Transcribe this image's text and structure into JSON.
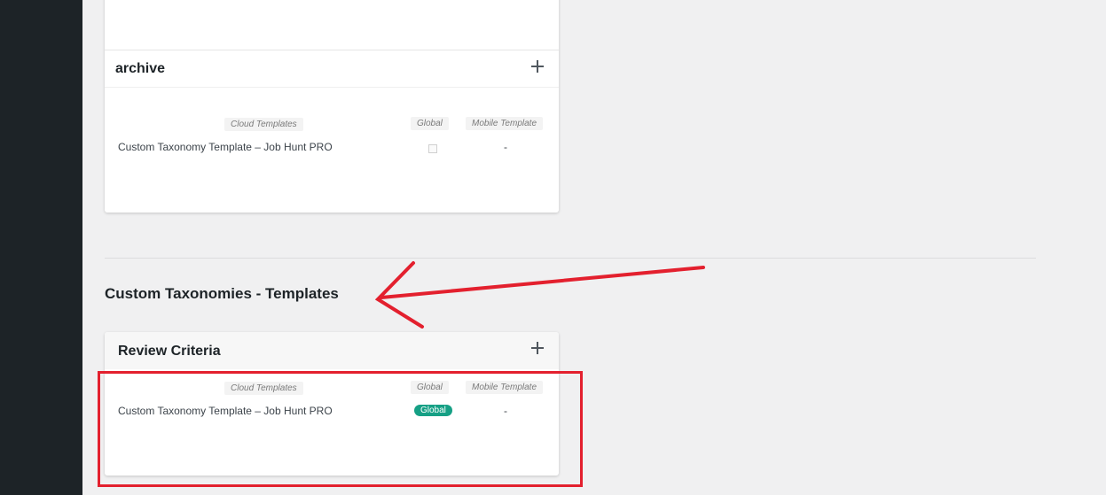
{
  "archive_card": {
    "title": "archive",
    "columns": {
      "cloud": "Cloud Templates",
      "global": "Global",
      "mobile": "Mobile Template"
    },
    "row": {
      "name": "Custom Taxonomy Template – Job Hunt PRO",
      "mobile": "-"
    }
  },
  "section": {
    "title": "Custom Taxonomies - Templates"
  },
  "review_card": {
    "title": "Review Criteria",
    "columns": {
      "cloud": "Cloud Templates",
      "global": "Global",
      "mobile": "Mobile Template"
    },
    "row": {
      "name": "Custom Taxonomy Template – Job Hunt PRO",
      "global_badge": "Global",
      "mobile": "-"
    }
  },
  "colors": {
    "sidebar": "#1d2327",
    "background": "#f0f0f1",
    "badge": "#16a085",
    "annotation": "#e3202e"
  }
}
